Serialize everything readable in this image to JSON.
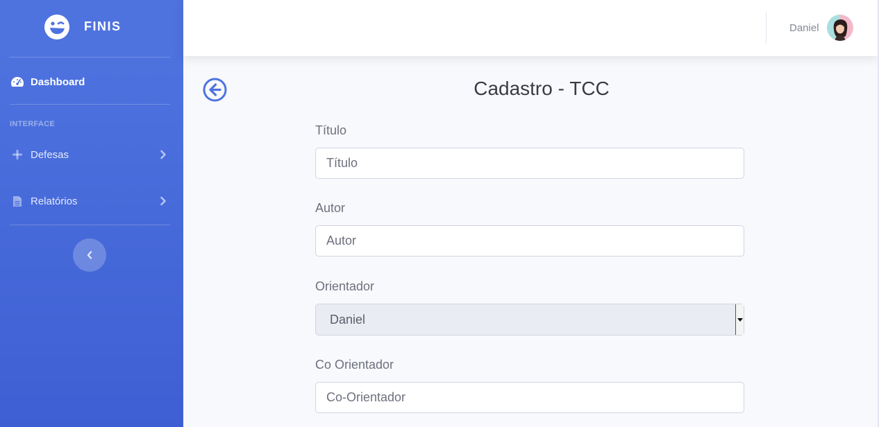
{
  "colors": {
    "sidebar_primary": "#4e73df",
    "sidebar_secondary": "#3e5fd3",
    "accent": "#4e73df",
    "page_background": "#f8f9fc"
  },
  "brand": {
    "name": "FINIS",
    "logo_icon": "winking-face-icon"
  },
  "sidebar": {
    "dashboard": {
      "label": "Dashboard",
      "icon": "tachometer-icon"
    },
    "section_heading": "INTERFACE",
    "items": [
      {
        "label": "Defesas",
        "icon": "plus-icon",
        "chevron": "chevron-right-icon"
      },
      {
        "label": "Relatórios",
        "icon": "file-icon",
        "chevron": "chevron-right-icon"
      }
    ],
    "toggle_icon": "chevron-left-icon"
  },
  "topbar": {
    "user_name": "Daniel",
    "avatar_icon": "user-avatar"
  },
  "page": {
    "title": "Cadastro - TCC",
    "back_icon": "arrow-left-circle-icon"
  },
  "form": {
    "titulo": {
      "label": "Título",
      "placeholder": "Título"
    },
    "autor": {
      "label": "Autor",
      "placeholder": "Autor"
    },
    "orientador": {
      "label": "Orientador",
      "selected": "Daniel"
    },
    "co_orientador": {
      "label": "Co Orientador",
      "placeholder": "Co-Orientador"
    }
  }
}
